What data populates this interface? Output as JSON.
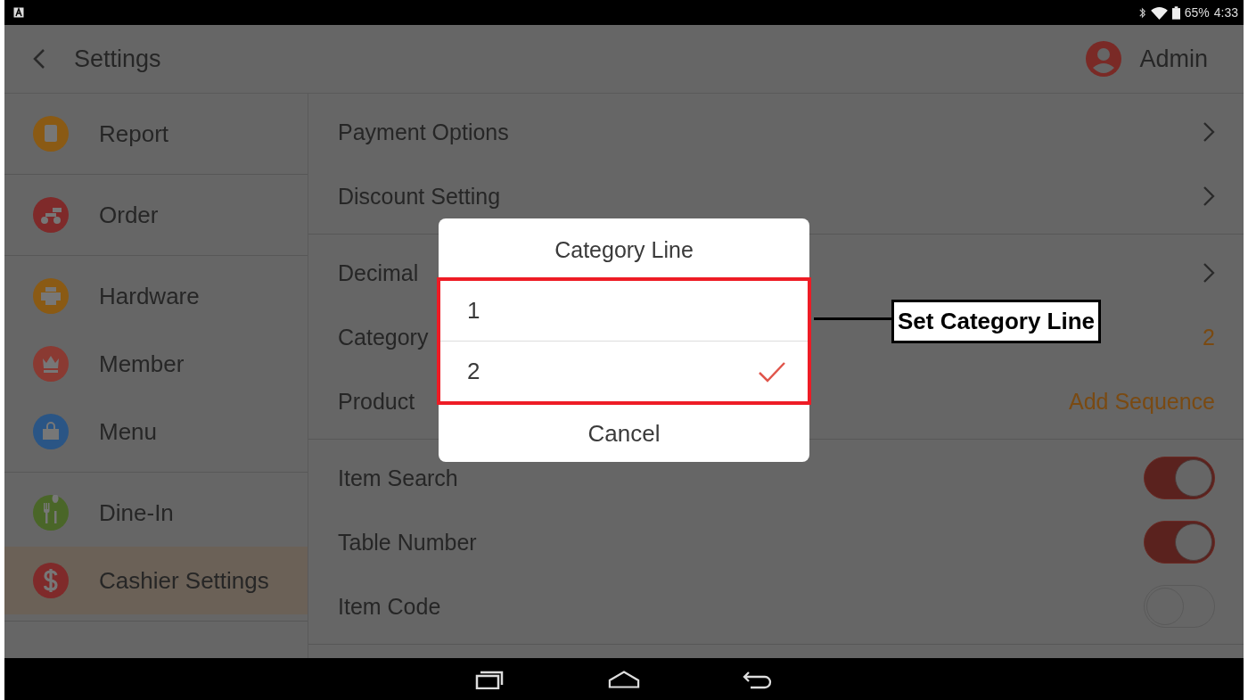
{
  "status_bar": {
    "battery": "65%",
    "time": "4:33"
  },
  "header": {
    "title": "Settings",
    "user": "Admin"
  },
  "sidebar": {
    "groups": [
      {
        "items": [
          {
            "label": "Report",
            "kind": "report",
            "selected": false
          }
        ]
      },
      {
        "items": [
          {
            "label": "Order",
            "kind": "order",
            "selected": false
          }
        ]
      },
      {
        "items": [
          {
            "label": "Hardware",
            "kind": "hardware",
            "selected": false
          },
          {
            "label": "Member",
            "kind": "member",
            "selected": false
          },
          {
            "label": "Menu",
            "kind": "menu",
            "selected": false
          }
        ]
      },
      {
        "items": [
          {
            "label": "Dine-In",
            "kind": "dinein",
            "selected": false
          },
          {
            "label": "Cashier Settings",
            "kind": "cashier",
            "selected": true
          }
        ]
      }
    ]
  },
  "settings": {
    "groups": [
      {
        "rows": [
          {
            "kind": "link",
            "label": "Payment Options"
          },
          {
            "kind": "link",
            "label": "Discount Setting"
          }
        ]
      },
      {
        "rows": [
          {
            "kind": "link",
            "label": "Decimal"
          },
          {
            "kind": "value",
            "label": "Category",
            "value": "2"
          },
          {
            "kind": "action",
            "label": "Product",
            "value": "Add Sequence"
          }
        ]
      },
      {
        "rows": [
          {
            "kind": "toggle",
            "label": "Item Search",
            "on": true
          },
          {
            "kind": "toggle",
            "label": "Table Number",
            "on": true
          },
          {
            "kind": "toggle",
            "label": "Item Code",
            "on": false
          }
        ]
      }
    ]
  },
  "dialog": {
    "title": "Category Line",
    "options": [
      {
        "label": "1",
        "selected": false
      },
      {
        "label": "2",
        "selected": true
      }
    ],
    "cancel": "Cancel"
  },
  "annotation": {
    "label": "Set Category Line"
  }
}
